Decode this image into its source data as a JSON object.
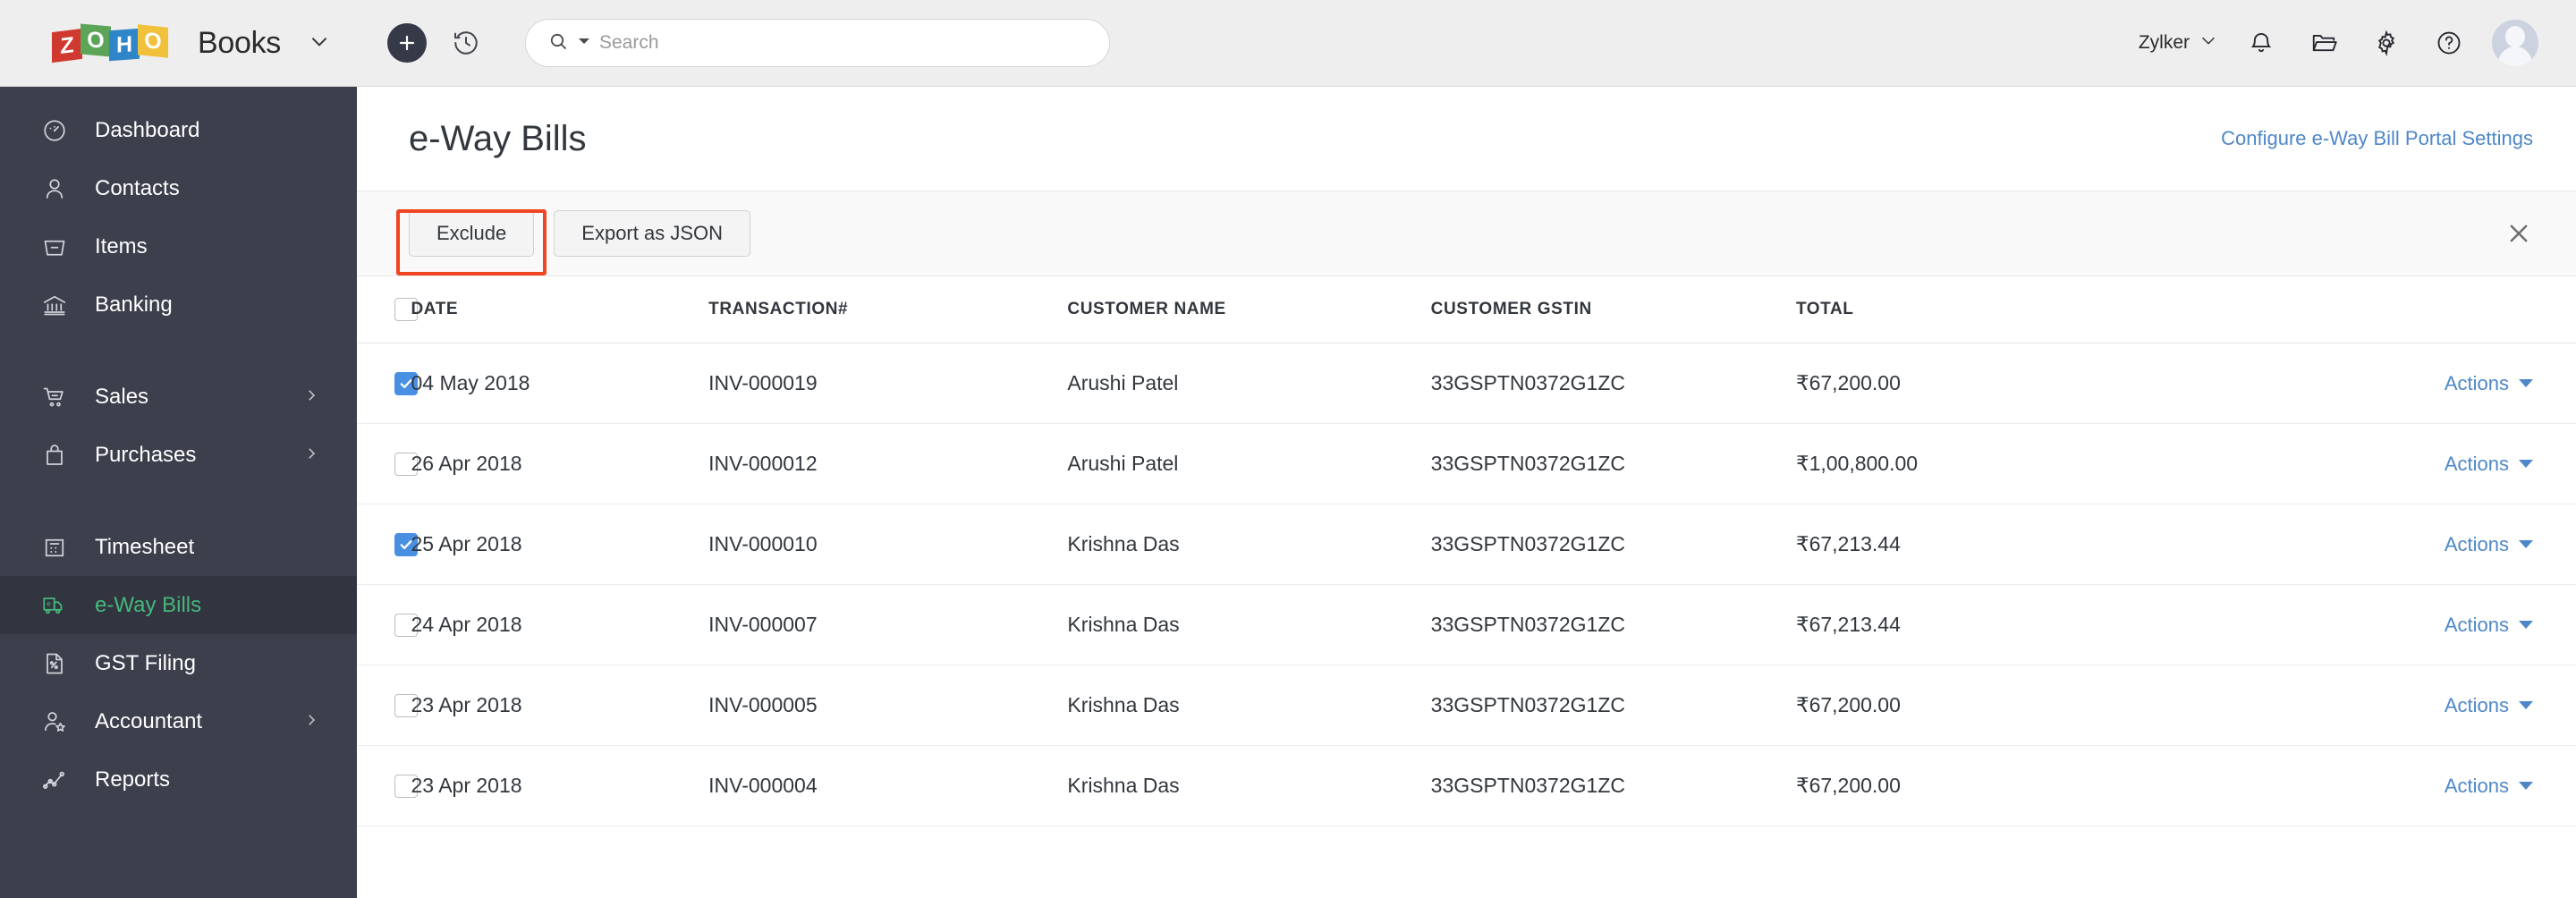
{
  "brand": {
    "logo_letters": [
      "Z",
      "O",
      "H",
      "O"
    ],
    "product": "Books",
    "dropdown_icon": "chevron-down-icon"
  },
  "topbar": {
    "create_label": "+",
    "create_icon": "plus-icon",
    "history_icon": "clock-history-icon",
    "search": {
      "placeholder": "Search",
      "value": "",
      "icon": "search-icon",
      "dropdown_icon": "caret-down-icon"
    },
    "org": {
      "name": "Zylker",
      "icon": "chevron-down-icon"
    },
    "icons": [
      {
        "name": "notifications-icon",
        "label": "Notifications"
      },
      {
        "name": "folder-icon",
        "label": "Documents"
      },
      {
        "name": "gear-icon",
        "label": "Settings"
      },
      {
        "name": "help-icon",
        "label": "Help"
      }
    ],
    "avatar": "user-avatar"
  },
  "sidebar": {
    "items": [
      {
        "label": "Dashboard",
        "icon": "dashboard-icon",
        "active": false,
        "has_arrow": false
      },
      {
        "label": "Contacts",
        "icon": "contacts-icon",
        "active": false,
        "has_arrow": false
      },
      {
        "label": "Items",
        "icon": "items-icon",
        "active": false,
        "has_arrow": false
      },
      {
        "label": "Banking",
        "icon": "banking-icon",
        "active": false,
        "has_arrow": false
      },
      {
        "label": "Sales",
        "icon": "sales-cart-icon",
        "active": false,
        "has_arrow": true
      },
      {
        "label": "Purchases",
        "icon": "purchases-bag-icon",
        "active": false,
        "has_arrow": true
      },
      {
        "label": "Timesheet",
        "icon": "timesheet-icon",
        "active": false,
        "has_arrow": false
      },
      {
        "label": "e-Way Bills",
        "icon": "eway-bill-truck-icon",
        "active": true,
        "has_arrow": false
      },
      {
        "label": "GST Filing",
        "icon": "gst-filing-icon",
        "active": false,
        "has_arrow": false
      },
      {
        "label": "Accountant",
        "icon": "accountant-icon",
        "active": false,
        "has_arrow": true
      },
      {
        "label": "Reports",
        "icon": "reports-chart-icon",
        "active": false,
        "has_arrow": false
      }
    ]
  },
  "page": {
    "title": "e-Way Bills",
    "configure_link": "Configure e-Way Bill Portal Settings"
  },
  "toolbar": {
    "exclude_label": "Exclude",
    "export_label": "Export as JSON",
    "close_icon": "close-icon",
    "highlight_color": "#f04522"
  },
  "table": {
    "select_all_checked": false,
    "columns": [
      "DATE",
      "TRANSACTION#",
      "CUSTOMER NAME",
      "CUSTOMER GSTIN",
      "TOTAL"
    ],
    "actions_label": "Actions",
    "rows": [
      {
        "checked": true,
        "date": "04 May 2018",
        "transaction": "INV-000019",
        "customer": "Arushi Patel",
        "gstin": "33GSPTN0372G1ZC",
        "total": "₹67,200.00"
      },
      {
        "checked": false,
        "date": "26 Apr 2018",
        "transaction": "INV-000012",
        "customer": "Arushi Patel",
        "gstin": "33GSPTN0372G1ZC",
        "total": "₹1,00,800.00"
      },
      {
        "checked": true,
        "date": "25 Apr 2018",
        "transaction": "INV-000010",
        "customer": "Krishna Das",
        "gstin": "33GSPTN0372G1ZC",
        "total": "₹67,213.44"
      },
      {
        "checked": false,
        "date": "24 Apr 2018",
        "transaction": "INV-000007",
        "customer": "Krishna Das",
        "gstin": "33GSPTN0372G1ZC",
        "total": "₹67,213.44"
      },
      {
        "checked": false,
        "date": "23 Apr 2018",
        "transaction": "INV-000005",
        "customer": "Krishna Das",
        "gstin": "33GSPTN0372G1ZC",
        "total": "₹67,200.00"
      },
      {
        "checked": false,
        "date": "23 Apr 2018",
        "transaction": "INV-000004",
        "customer": "Krishna Das",
        "gstin": "33GSPTN0372G1ZC",
        "total": "₹67,200.00"
      }
    ]
  },
  "colors": {
    "sidebar_bg": "#3c3f4c",
    "sidebar_active_bg": "#32343f",
    "accent_green": "#45b87c",
    "link_blue": "#4e87c7",
    "checkbox_blue": "#4a90e2",
    "highlight_red": "#f04522"
  }
}
